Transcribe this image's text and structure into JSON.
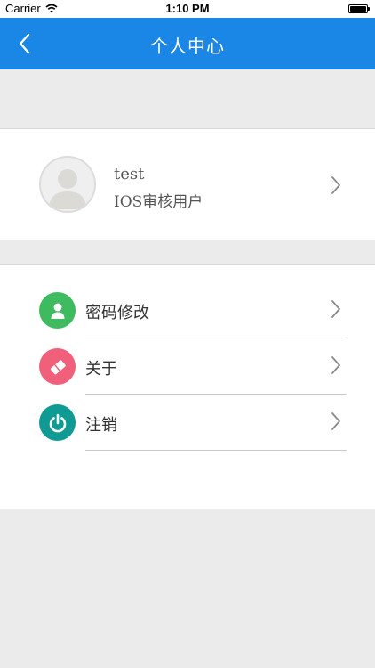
{
  "status_bar": {
    "carrier": "Carrier",
    "time": "1:10 PM",
    "wifi_icon": "wifi-icon",
    "battery_icon": "battery-full-icon"
  },
  "nav": {
    "title": "个人中心",
    "back_icon": "chevron-left-icon",
    "background_color": "#1a86e5"
  },
  "profile": {
    "name": "test",
    "role": "IOS审核用户",
    "avatar_icon": "default-avatar-icon",
    "chevron_icon": "chevron-right-icon"
  },
  "menu": {
    "items": [
      {
        "label": "密码修改",
        "icon": "user-icon",
        "color": "#3dbb5e"
      },
      {
        "label": "关于",
        "icon": "eraser-icon",
        "color": "#f0607a"
      },
      {
        "label": "注销",
        "icon": "power-icon",
        "color": "#0f9a93"
      }
    ],
    "chevron_icon": "chevron-right-icon"
  }
}
